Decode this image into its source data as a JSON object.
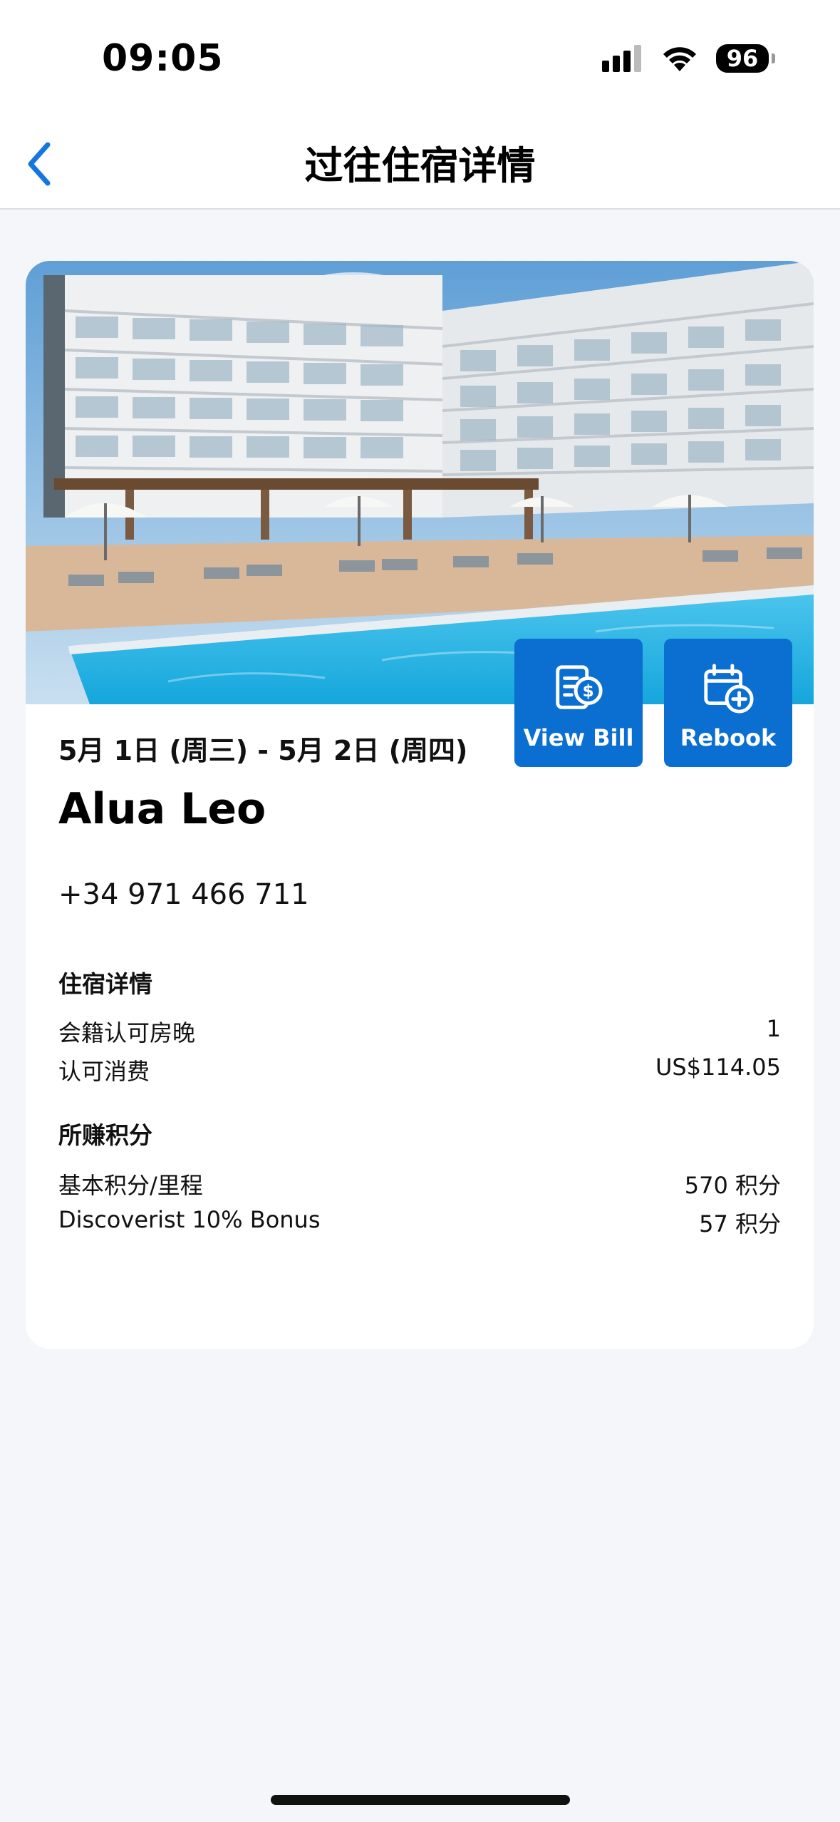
{
  "status_bar": {
    "time": "09:05",
    "battery": "96"
  },
  "nav": {
    "title": "过往住宿详情"
  },
  "stay": {
    "dates": "5月 1日 (周三) - 5月 2日 (周四)",
    "hotel_name": "Alua Leo",
    "phone": "+34 971 466 711",
    "actions": {
      "view_bill": "View Bill",
      "rebook": "Rebook"
    }
  },
  "stay_details": {
    "title": "住宿详情",
    "rows": [
      {
        "label": "会籍认可房晚",
        "value": "1"
      },
      {
        "label": "认可消费",
        "value": "US$114.05"
      }
    ]
  },
  "points_earned": {
    "title": "所赚积分",
    "rows": [
      {
        "label": "基本积分/里程",
        "value": "570 积分"
      },
      {
        "label": "Discoverist 10% Bonus",
        "value": "57 积分"
      }
    ]
  },
  "colors": {
    "accent": "#0a6fd0",
    "background": "#f4f6fa",
    "pool": "#2ab8e6"
  }
}
